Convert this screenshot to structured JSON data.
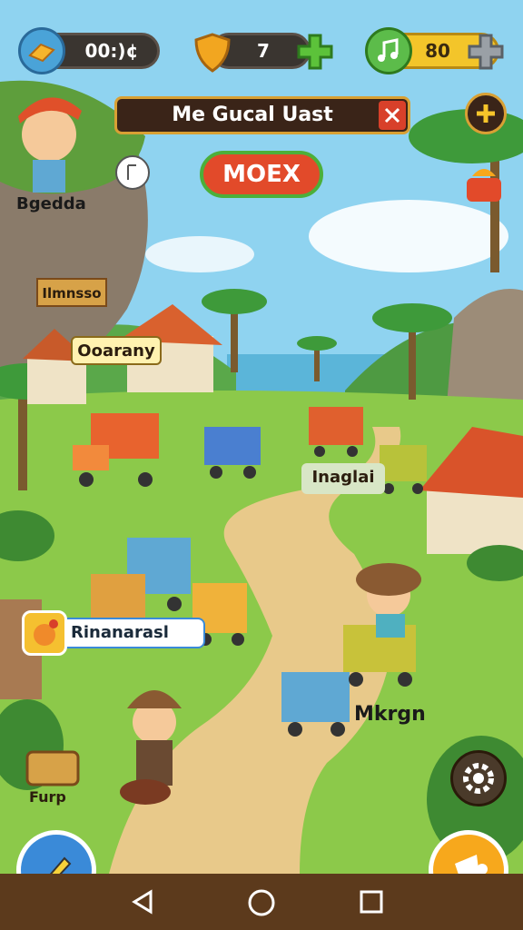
{
  "resources": {
    "gems_value": "00:)¢",
    "shield_value": "7",
    "music_value": "80"
  },
  "banner": {
    "title": "Me Gucal Uast"
  },
  "center_button": {
    "label": "MOEX"
  },
  "map_labels": {
    "player_name": "Bgedda",
    "sign_1": "Ilmnsso",
    "sign_2": "Ooarany",
    "sign_3": "Inaglai",
    "notification": "Rinanarasl",
    "character_label": "Mkrgn",
    "chest_label": "Furp"
  },
  "colors": {
    "sky": "#8fd3f0",
    "grass": "#8cc94a",
    "path": "#e8c98a",
    "accent_orange": "#f7a81c",
    "accent_red": "#e24a2a",
    "accent_green": "#4caf3a"
  }
}
